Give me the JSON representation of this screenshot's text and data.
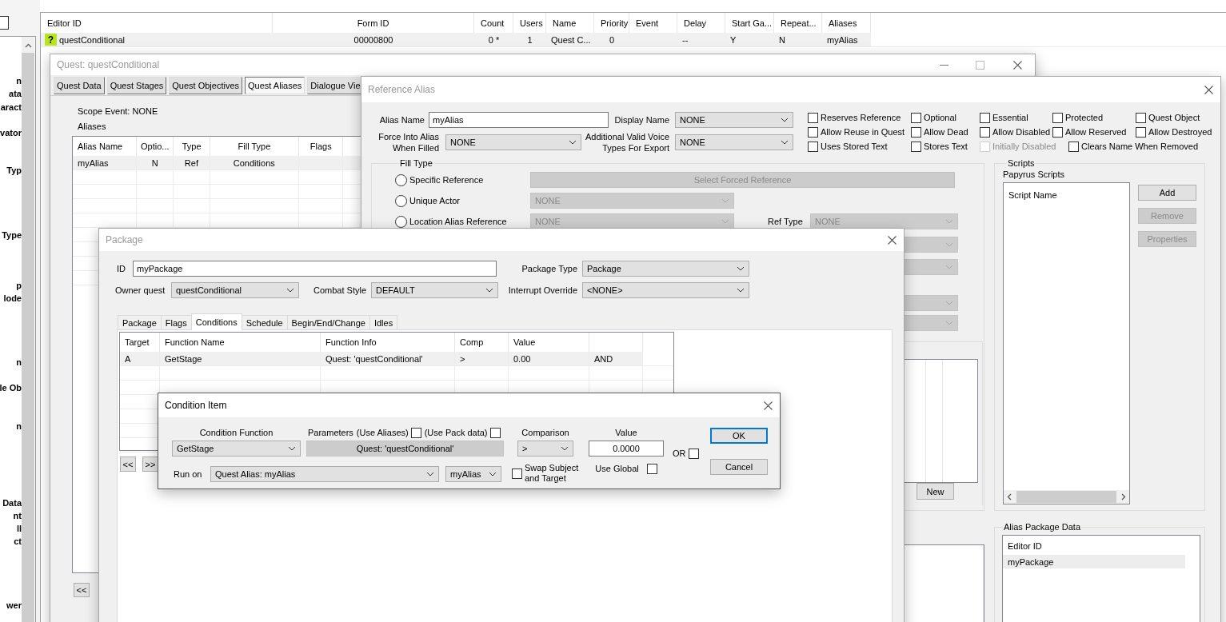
{
  "sidebar": {
    "items": [
      "n",
      "ata",
      "aract",
      "vator",
      "Typ",
      "Type",
      "p",
      "lode",
      "n",
      "le Ob",
      "n",
      "Data",
      "nt",
      "ll",
      "ct",
      "wer"
    ]
  },
  "record_list": {
    "columns": [
      "Editor ID",
      "Form ID",
      "Count",
      "Users",
      "Name",
      "Priority",
      "Event",
      "Delay",
      "Start Ga...",
      "Repeat...",
      "Aliases"
    ],
    "rows": [
      {
        "status": "?",
        "selected": true,
        "cells": [
          "questConditional",
          "00000800",
          "0 *",
          "1",
          "Quest C...",
          "0",
          null,
          "--",
          "Y",
          "N",
          "myAlias"
        ]
      }
    ]
  },
  "quest_window": {
    "title": "Quest: questConditional",
    "active": false,
    "tabs": [
      {
        "label": "Quest Data",
        "selected": false
      },
      {
        "label": "Quest Stages",
        "selected": false
      },
      {
        "label": "Quest Objectives",
        "selected": false
      },
      {
        "label": "Quest Aliases",
        "selected": true
      },
      {
        "label": "Dialogue Vie",
        "selected": false
      }
    ],
    "scope_event": "Scope Event: NONE",
    "aliases_label": "Aliases",
    "alias_table": {
      "columns": [
        "Alias Name",
        "Optio...",
        "Type",
        "Fill Type",
        "Flags"
      ],
      "rows": [
        {
          "selected": true,
          "cells": [
            "myAlias",
            "N",
            "Ref",
            "Conditions",
            null
          ]
        }
      ]
    },
    "nav_buttons": [
      "<<"
    ]
  },
  "reference_alias_window": {
    "title": "Reference Alias",
    "active": false,
    "alias_name": {
      "label": "Alias Name",
      "value": "myAlias"
    },
    "display_name": {
      "label": "Display Name",
      "value": "NONE"
    },
    "force_into_alias": {
      "label_lines": [
        "Force Into Alias",
        "When Filled"
      ],
      "value": "NONE"
    },
    "voice_types": {
      "label_lines": [
        "Additional Valid Voice",
        "Types For Export"
      ],
      "value": "NONE"
    },
    "flags": [
      [
        {
          "label": "Reserves Reference",
          "checked": false,
          "disabled": false
        },
        {
          "label": "Optional",
          "checked": false,
          "disabled": false
        },
        {
          "label": "Essential",
          "checked": false,
          "disabled": false
        },
        {
          "label": "Protected",
          "checked": false,
          "disabled": false
        },
        {
          "label": "Quest Object",
          "checked": false,
          "disabled": false
        }
      ],
      [
        {
          "label": "Allow Reuse in Quest",
          "checked": false,
          "disabled": false
        },
        {
          "label": "Allow Dead",
          "checked": false,
          "disabled": false
        },
        {
          "label": "Allow Disabled",
          "checked": false,
          "disabled": false
        },
        {
          "label": "Allow Reserved",
          "checked": false,
          "disabled": false
        },
        {
          "label": "Allow Destroyed",
          "checked": false,
          "disabled": false
        }
      ],
      [
        {
          "label": "Uses Stored Text",
          "checked": false,
          "disabled": false
        },
        {
          "label": "Stores Text",
          "checked": false,
          "disabled": false
        },
        {
          "label": "Initially Disabled",
          "checked": false,
          "disabled": true
        },
        {
          "label": "Clears Name When Removed",
          "checked": false,
          "disabled": false
        }
      ]
    ],
    "fill_type": {
      "label": "Fill Type",
      "options": [
        {
          "label": "Specific Reference",
          "selected": false,
          "control": {
            "kind": "button",
            "text": "Select Forced Reference",
            "disabled": true
          }
        },
        {
          "label": "Unique Actor",
          "selected": false,
          "control": {
            "kind": "dropdown",
            "value": "NONE",
            "disabled": true
          }
        },
        {
          "label": "Location Alias Reference",
          "selected": false,
          "control": {
            "kind": "dropdown",
            "value": "NONE",
            "disabled": true
          },
          "extra": {
            "label": "Ref Type",
            "value": "NONE",
            "disabled": true
          }
        }
      ],
      "more_dropdowns": [
        {
          "disabled": true
        },
        {
          "disabled": true
        },
        {
          "disabled": true
        },
        {
          "disabled": true
        }
      ],
      "new_button": "New"
    },
    "scripts": {
      "label": "Scripts",
      "sublabel": "Papyrus Scripts",
      "list_header": "Script Name",
      "buttons": [
        {
          "label": "Add",
          "disabled": false
        },
        {
          "label": "Remove",
          "disabled": true
        },
        {
          "label": "Properties",
          "disabled": true
        }
      ]
    },
    "alias_package_data": {
      "label": "Alias Package Data",
      "header": "Editor ID",
      "rows": [
        {
          "name": "myPackage",
          "selected": true
        }
      ]
    }
  },
  "package_window": {
    "title": "Package",
    "active": false,
    "id": {
      "label": "ID",
      "value": "myPackage"
    },
    "package_type": {
      "label": "Package Type",
      "value": "Package"
    },
    "owner_quest": {
      "label": "Owner quest",
      "value": "questConditional"
    },
    "combat_style": {
      "label": "Combat Style",
      "value": "DEFAULT"
    },
    "interrupt_override": {
      "label": "Interrupt Override",
      "value": "<NONE>"
    },
    "tabs": [
      {
        "label": "Package",
        "selected": false
      },
      {
        "label": "Flags",
        "selected": false
      },
      {
        "label": "Conditions",
        "selected": true
      },
      {
        "label": "Schedule",
        "selected": false
      },
      {
        "label": "Begin/End/Change",
        "selected": false
      },
      {
        "label": "Idles",
        "selected": false
      }
    ],
    "conditions_table": {
      "columns": [
        "Target",
        "Function Name",
        "Function Info",
        "Comp",
        "Value"
      ],
      "rows": [
        {
          "selected": true,
          "cells": [
            "A",
            "GetStage",
            "Quest: 'questConditional'",
            ">",
            "0.00",
            "AND"
          ]
        }
      ]
    },
    "nav_buttons": [
      "<<",
      ">>"
    ]
  },
  "condition_item_window": {
    "title": "Condition Item",
    "active": true,
    "condition_function": {
      "label": "Condition Function",
      "value": "GetStage"
    },
    "parameters": {
      "label": "Parameters",
      "use_aliases": {
        "label": "(Use Aliases)",
        "checked": false
      },
      "use_pack_data": {
        "label": "(Use Pack data)",
        "checked": false
      },
      "value": "Quest: 'questConditional'"
    },
    "comparison": {
      "label": "Comparison",
      "value": ">"
    },
    "value": {
      "label": "Value",
      "value": "0.0000"
    },
    "or": {
      "label": "OR",
      "checked": false
    },
    "run_on": {
      "label": "Run on",
      "value": "Quest Alias: myAlias",
      "alias": "myAlias"
    },
    "swap": {
      "label_lines": [
        "Swap Subject",
        "and Target"
      ],
      "checked": false
    },
    "use_global": {
      "label": "Use Global",
      "checked": false
    },
    "buttons": [
      {
        "label": "OK",
        "default": true
      },
      {
        "label": "Cancel",
        "default": false
      }
    ]
  }
}
